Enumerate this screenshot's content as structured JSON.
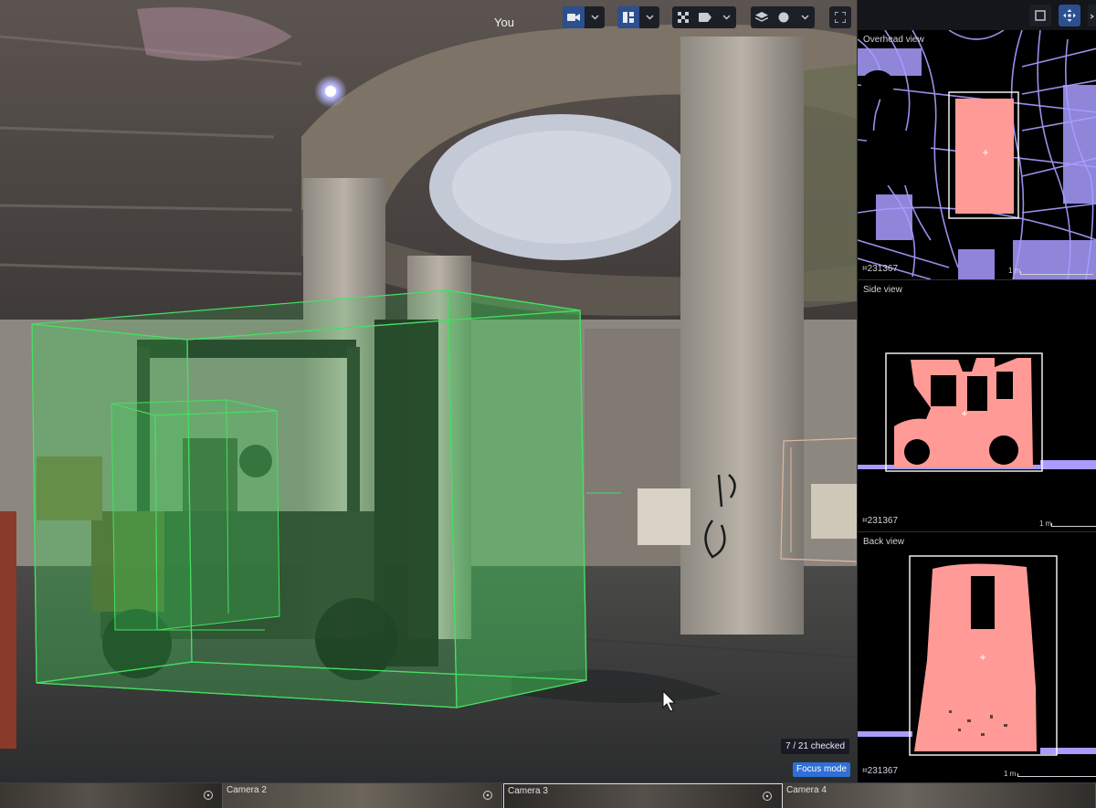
{
  "viewer": {
    "current_user": "You"
  },
  "main_toolbar": {
    "groups": [
      {
        "name": "camera",
        "icon": "video-camera-icon",
        "active": true
      },
      {
        "name": "layout",
        "icon": "layout-grid-icon",
        "active": true
      },
      {
        "name": "display",
        "icons": [
          "checkerboard-icon",
          "label-tag-icon"
        ]
      },
      {
        "name": "layers",
        "icons": [
          "layers-icon",
          "circle-icon"
        ]
      },
      {
        "name": "fullscreen",
        "icon": "fullscreen-icon"
      }
    ]
  },
  "status": {
    "progress": "7 / 21 checked",
    "mode": "Focus mode"
  },
  "panes": [
    {
      "title": "Overhead view",
      "object_id": "231367",
      "scale": "1 m"
    },
    {
      "title": "Side view",
      "object_id": "231367",
      "scale": "1 m"
    },
    {
      "title": "Back view",
      "object_id": "231367",
      "scale": "1 m"
    }
  ],
  "cameras": [
    {
      "label": ""
    },
    {
      "label": "Camera 2"
    },
    {
      "label": "Camera 3"
    },
    {
      "label": "Camera 4"
    }
  ],
  "colors": {
    "cuboid_active": "#39d45a",
    "cuboid_inactive": "#e0b8a0",
    "points_pointcloud": "#a89cff",
    "points_selected": "#ff9a96",
    "toolbar_active": "#2c4f8f",
    "badge_focus": "#2f6fd6"
  }
}
